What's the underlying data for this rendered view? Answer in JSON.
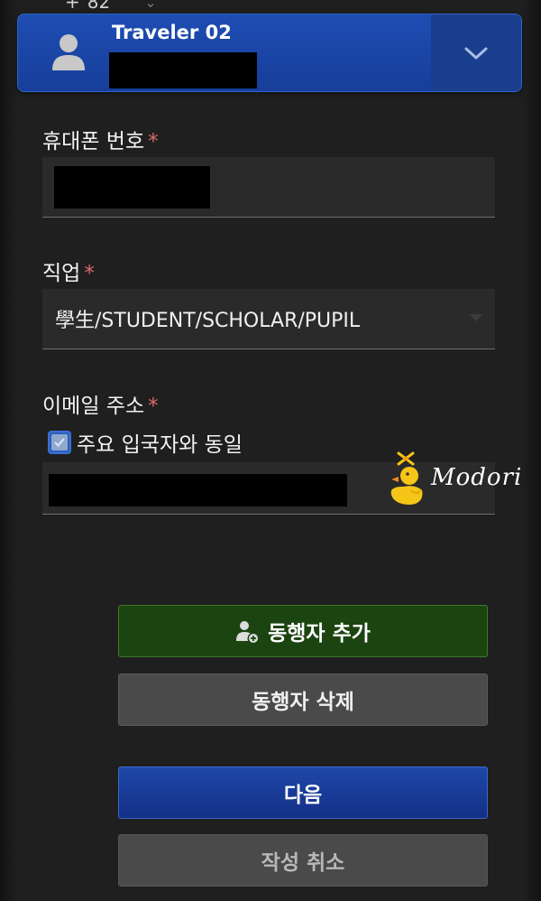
{
  "top_peek": {
    "symbol": "+",
    "value": "82"
  },
  "traveler": {
    "name": "Traveler 02",
    "avatar_icon": "user-icon",
    "expand_icon": "chevron-down-icon"
  },
  "fields": {
    "phone": {
      "label": "휴대폰 번호",
      "required_mark": "*"
    },
    "occupation": {
      "label": "직업",
      "required_mark": "*",
      "selected": "學生/STUDENT/SCHOLAR/PUPIL"
    },
    "email": {
      "label": "이메일 주소",
      "required_mark": "*",
      "same_as_main_label": "주요 입국자와 동일",
      "same_as_main_checked": true
    }
  },
  "watermark": {
    "text": "Modori"
  },
  "buttons": {
    "add_companion": "동행자 추가",
    "add_companion_icon": "add-user-icon",
    "delete_companion": "동행자 삭제",
    "next": "다음",
    "cancel": "작성 취소"
  },
  "colors": {
    "accent_blue": "#1e4db3",
    "add_green": "#1c4410",
    "required_red": "#e06a6a"
  }
}
